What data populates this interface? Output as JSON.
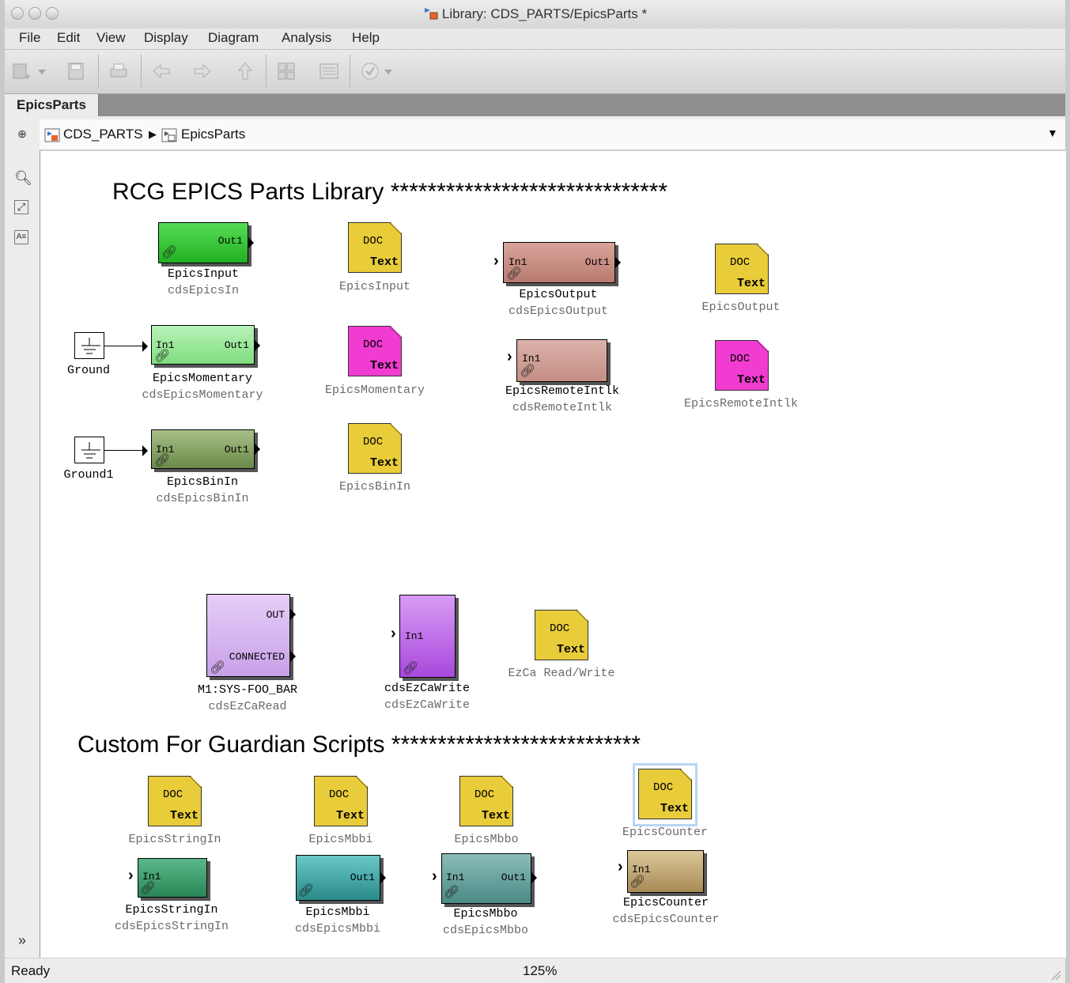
{
  "window": {
    "title": "Library: CDS_PARTS/EpicsParts *"
  },
  "menu": [
    "File",
    "Edit",
    "View",
    "Display",
    "Diagram",
    "Analysis",
    "Help"
  ],
  "tab": {
    "label": "EpicsParts"
  },
  "breadcrumb": {
    "root": "CDS_PARTS",
    "child": "EpicsParts"
  },
  "headings": {
    "main": "RCG EPICS Parts Library ******************************",
    "guardian": "Custom For Guardian Scripts ***************************"
  },
  "doc": {
    "top": "DOC",
    "bottom": "Text"
  },
  "blocks": {
    "epics_input": {
      "name": "EpicsInput",
      "sub": "cdsEpicsIn",
      "out": "Out1"
    },
    "epics_momentary": {
      "name": "EpicsMomentary",
      "sub": "cdsEpicsMomentary",
      "in": "In1",
      "out": "Out1"
    },
    "epics_binin": {
      "name": "EpicsBinIn",
      "sub": "cdsEpicsBinIn",
      "in": "In1",
      "out": "Out1"
    },
    "epics_output": {
      "name": "EpicsOutput",
      "sub": "cdsEpicsOutput",
      "in": "In1",
      "out": "Out1"
    },
    "epics_remote": {
      "name": "EpicsRemoteIntlk",
      "sub": "cdsRemoteIntlk",
      "in": "In1"
    },
    "ground": {
      "name": "Ground"
    },
    "ground1": {
      "name": "Ground1"
    },
    "ezca_read": {
      "name": "M1:SYS-FOO_BAR",
      "sub": "cdsEzCaRead",
      "out": "OUT",
      "connected": "CONNECTED"
    },
    "ezca_write": {
      "name": "cdsEzCaWrite",
      "sub": "cdsEzCaWrite",
      "in": "In1"
    },
    "string_in": {
      "name": "EpicsStringIn",
      "sub": "cdsEpicsStringIn",
      "in": "In1"
    },
    "mbbi": {
      "name": "EpicsMbbi",
      "sub": "cdsEpicsMbbi",
      "out": "Out1"
    },
    "mbbo": {
      "name": "EpicsMbbo",
      "sub": "cdsEpicsMbbo",
      "in": "In1",
      "out": "Out1"
    },
    "counter": {
      "name": "EpicsCounter",
      "sub": "cdsEpicsCounter",
      "in": "In1"
    }
  },
  "doc_labels": {
    "input": "EpicsInput",
    "output": "EpicsOutput",
    "momentary": "EpicsMomentary",
    "remote": "EpicsRemoteIntlk",
    "binin": "EpicsBinIn",
    "ezca": "EzCa Read/Write",
    "string_in": "EpicsStringIn",
    "mbbi": "EpicsMbbi",
    "mbbo": "EpicsMbbo",
    "counter": "EpicsCounter"
  },
  "colors": {
    "doc_yellow": "#e8cc3a",
    "doc_magenta": "#f03cd0",
    "input_green": "#33cc33",
    "momentary_green": "#99e899",
    "binin_green": "#7a9a55",
    "output_brown": "#c98d83",
    "remote_brown": "#d4a59c",
    "ezca_read": "#dcbdf0",
    "ezca_write": "#b860e8",
    "string_in": "#3a9a6a",
    "mbbi": "#3aa4a4",
    "mbbo": "#5a9a94",
    "counter": "#c4aa78"
  },
  "status": {
    "left": "Ready",
    "zoom": "125%"
  }
}
